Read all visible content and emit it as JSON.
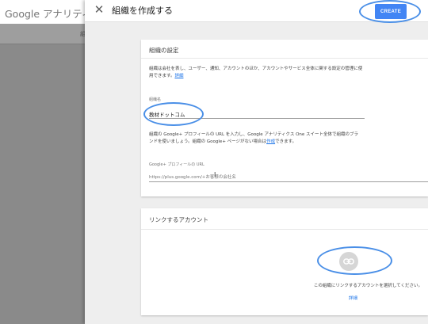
{
  "background": {
    "logo": "Google アナリティクス",
    "tab_fragment": "組"
  },
  "panel": {
    "close_icon": "close-icon",
    "title": "組織を作成する",
    "create_label": "CREATE",
    "accent_color": "#4285f4"
  },
  "org_settings": {
    "title": "組織の設定",
    "description": "組織は会社を表し、ユーザー、通知、アカウントのほか、アカウントやサービス全体に関する設定の管理に使用できます。",
    "description_link": "詳細",
    "name_label": "組織名",
    "name_value": "教材ドットコム",
    "gplus_description": "組織の Google+ プロフィールの URL を入力し、Google アナリティクス One スイート全体で組織のブランドを使いましょう。組織の Google+ ページがない場合は",
    "gplus_link": "作成",
    "gplus_suffix": "できます。",
    "gplus_label": "Google+ プロフィールの URL",
    "gplus_placeholder": "https://plus.google.com/+お客様の会社名"
  },
  "linked_accounts": {
    "title": "リンクするアカウント",
    "icon": "link-icon",
    "prompt": "この組織にリンクするアカウントを選択してください。",
    "detail_link": "詳細"
  }
}
